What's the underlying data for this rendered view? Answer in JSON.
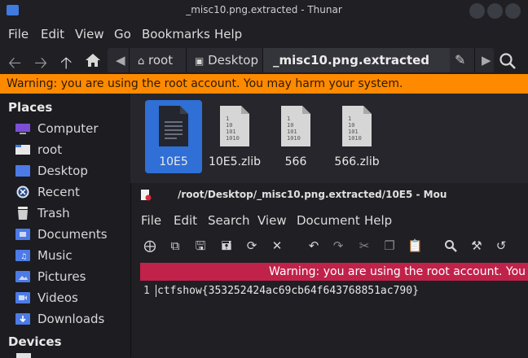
{
  "thunar": {
    "title": "_misc10.png.extracted - Thunar",
    "menu": [
      "File",
      "Edit",
      "View",
      "Go",
      "Bookmarks",
      "Help"
    ],
    "breadcrumbs": [
      "root",
      "Desktop",
      "_misc10.png.extracted"
    ],
    "warning": "Warning: you are using the root account. You may harm your system.",
    "sidebar": {
      "places_label": "Places",
      "places": [
        "Computer",
        "root",
        "Desktop",
        "Recent",
        "Trash",
        "Documents",
        "Music",
        "Pictures",
        "Videos",
        "Downloads"
      ],
      "devices_label": "Devices"
    },
    "files": [
      {
        "name": "10E5",
        "icon": "text-document-icon"
      },
      {
        "name": "10E5.zlib",
        "icon": "binary-file-icon",
        "glyph": "1\n10\n101\n1010"
      },
      {
        "name": "566",
        "icon": "binary-file-icon",
        "glyph": "1\n10\n101\n1010"
      },
      {
        "name": "566.zlib",
        "icon": "binary-file-icon",
        "glyph": "1\n10\n101\n1010"
      }
    ]
  },
  "mousepad": {
    "title": "/root/Desktop/_misc10.png.extracted/10E5 - Mou",
    "menu": [
      "File",
      "Edit",
      "Search",
      "View",
      "Document",
      "Help"
    ],
    "warning": "Warning: you are using the root account. You may",
    "line_number": "1",
    "content": "ctfshow{353252424ac69cb64f643768851ac790}"
  },
  "colors": {
    "accent": "#2f6fd6",
    "warning_orange": "#ff8a00",
    "warning_red": "#c1224a"
  }
}
